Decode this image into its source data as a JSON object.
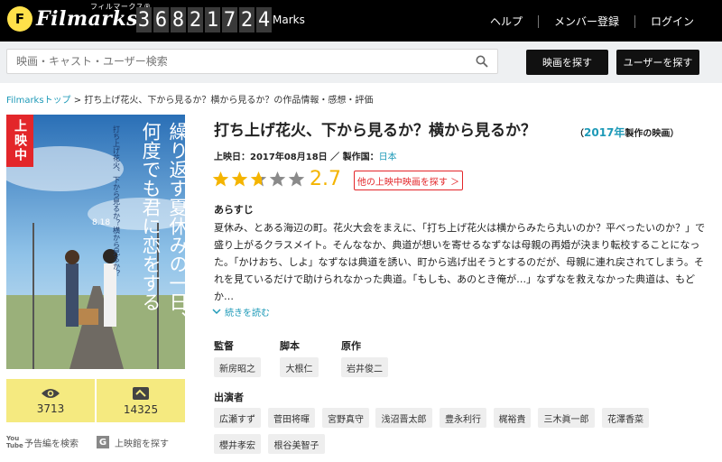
{
  "header": {
    "logo_mark": "F",
    "logo_text": "Filmarks",
    "logo_kana": "フィルマークス®",
    "counter_digits": [
      "3",
      "6",
      "8",
      "2",
      "1",
      "7",
      "2",
      "4"
    ],
    "marks_label": "Marks",
    "nav": [
      "ヘルプ",
      "メンバー登録",
      "ログイン"
    ]
  },
  "search": {
    "placeholder": "映画・キャスト・ユーザー検索",
    "find_movie_button": "映画を探す",
    "find_user_button": "ユーザーを探す"
  },
  "breadcrumb": {
    "home": "Filmarksトップ",
    "separator": ">",
    "current": "打ち上げ花火、下から見るか？横から見るか？の作品情報・感想・評価"
  },
  "poster": {
    "badge": "上映中",
    "vertical_title": "繰り返す夏休みの一日、",
    "vertical_title2": "何度でも君に恋をする",
    "small_title": "打ち上げ花火、下から見るか？横から見るか？",
    "date_text": "8.18"
  },
  "stats": {
    "views_count": "3713",
    "clips_count": "14325"
  },
  "poster_links": {
    "trailer": "予告編を検索",
    "theater": "上映館を探す",
    "yt_icon_text": "You Tube",
    "g_icon_text": "G"
  },
  "movie": {
    "title": "打ち上げ花火、下から見るか？横から見るか？",
    "year_open": "（",
    "year": "2017年",
    "year_suffix": "製作の映画）",
    "release_label": "上映日：2017年08月18日 ／ 製作国：",
    "country": "日本",
    "rating": 2.7,
    "rating_text": "2.7",
    "other_showing_button": "他の上映中映画を探す ＞",
    "synopsis_heading": "あらすじ",
    "synopsis": "夏休み、とある海辺の町。花火大会をまえに、「打ち上げ花火は横からみたら丸いのか？平べったいのか？」で盛り上がるクラスメイト。そんななか、典道が想いを寄せるなずなは母親の再婚が決まり転校することになった。「かけおち、しよ」なずなは典道を誘い、町から逃げ出そうとするのだが、母親に連れ戻されてしまう。それを見ているだけで助けられなかった典道。「もしも、あのとき俺が…」なずなを救えなかった典道は、もどか…",
    "read_more": "続きを読む"
  },
  "credits": {
    "director_label": "監督",
    "director": "新房昭之",
    "writer_label": "脚本",
    "writer": "大根仁",
    "original_label": "原作",
    "original": "岩井俊二",
    "cast_label": "出演者",
    "cast": [
      "広瀬すず",
      "菅田将暉",
      "宮野真守",
      "浅沼晋太郎",
      "豊永利行",
      "梶裕貴",
      "三木眞一郎",
      "花澤香菜",
      "櫻井孝宏",
      "根谷美智子"
    ]
  },
  "colors": {
    "accent": "#1e9ab8",
    "star": "#f4b400",
    "badge_red": "#e3262a",
    "stat_yellow": "#f5ea80"
  }
}
